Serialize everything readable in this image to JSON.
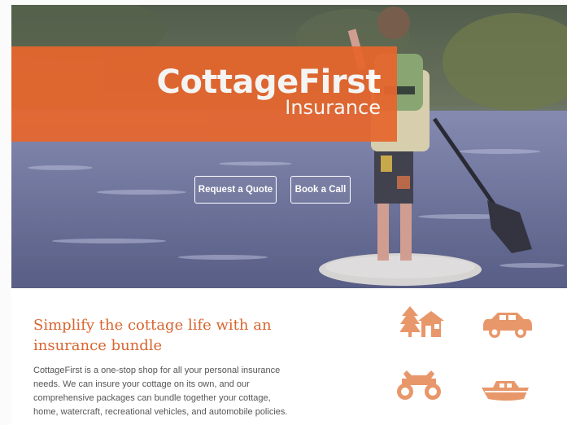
{
  "brand": {
    "name": "CottageFirst",
    "tagline": "Insurance"
  },
  "hero": {
    "buttons": {
      "quote_label": "Request a Quote",
      "call_label": "Book a Call"
    }
  },
  "intro": {
    "headline": "Simplify the cottage life with an insurance bundle",
    "body": "CottageFirst is a one-stop shop for all your personal insurance needs. We can insure your cottage on its own, and our comprehensive packages can bundle together your cottage, home, watercraft, recreational vehicles, and automobile policies."
  },
  "icons": [
    "cottage-icon",
    "car-icon",
    "atv-icon",
    "boat-icon"
  ],
  "colors": {
    "brand_orange": "#e7662d",
    "headline": "#d9652e",
    "icon": "#e8976a"
  }
}
